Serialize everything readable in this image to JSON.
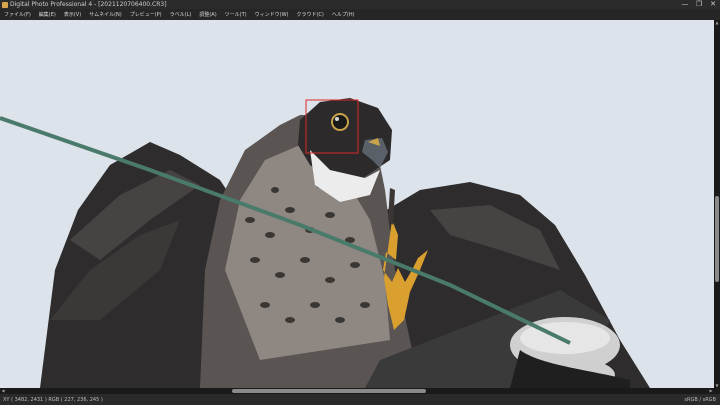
{
  "window": {
    "title": "Digital Photo Professional 4 - [2021120706400.CR3]",
    "controls": {
      "minimize": "—",
      "restore": "❐",
      "close": "✕"
    }
  },
  "menu": {
    "items": [
      "ファイル(F)",
      "編集(E)",
      "表示(V)",
      "サムネイル(N)",
      "プレビュー(P)",
      "ラベル(L)",
      "調整(A)",
      "ツール(T)",
      "ウィンドウ(W)",
      "クラウド(C)",
      "ヘルプ(H)"
    ]
  },
  "viewer": {
    "image_subject": "peregrine-falcon-photo",
    "focus_frame_color": "#d92b2b",
    "sky_color": "#dde3ea"
  },
  "status": {
    "left": "XY ( 3482, 2431 ) RGB ( 227, 236, 245 )",
    "right": "sRGB / sRGB"
  },
  "scrollbars": {
    "up": "▲",
    "down": "▼",
    "left": "◀",
    "right": "▶"
  }
}
